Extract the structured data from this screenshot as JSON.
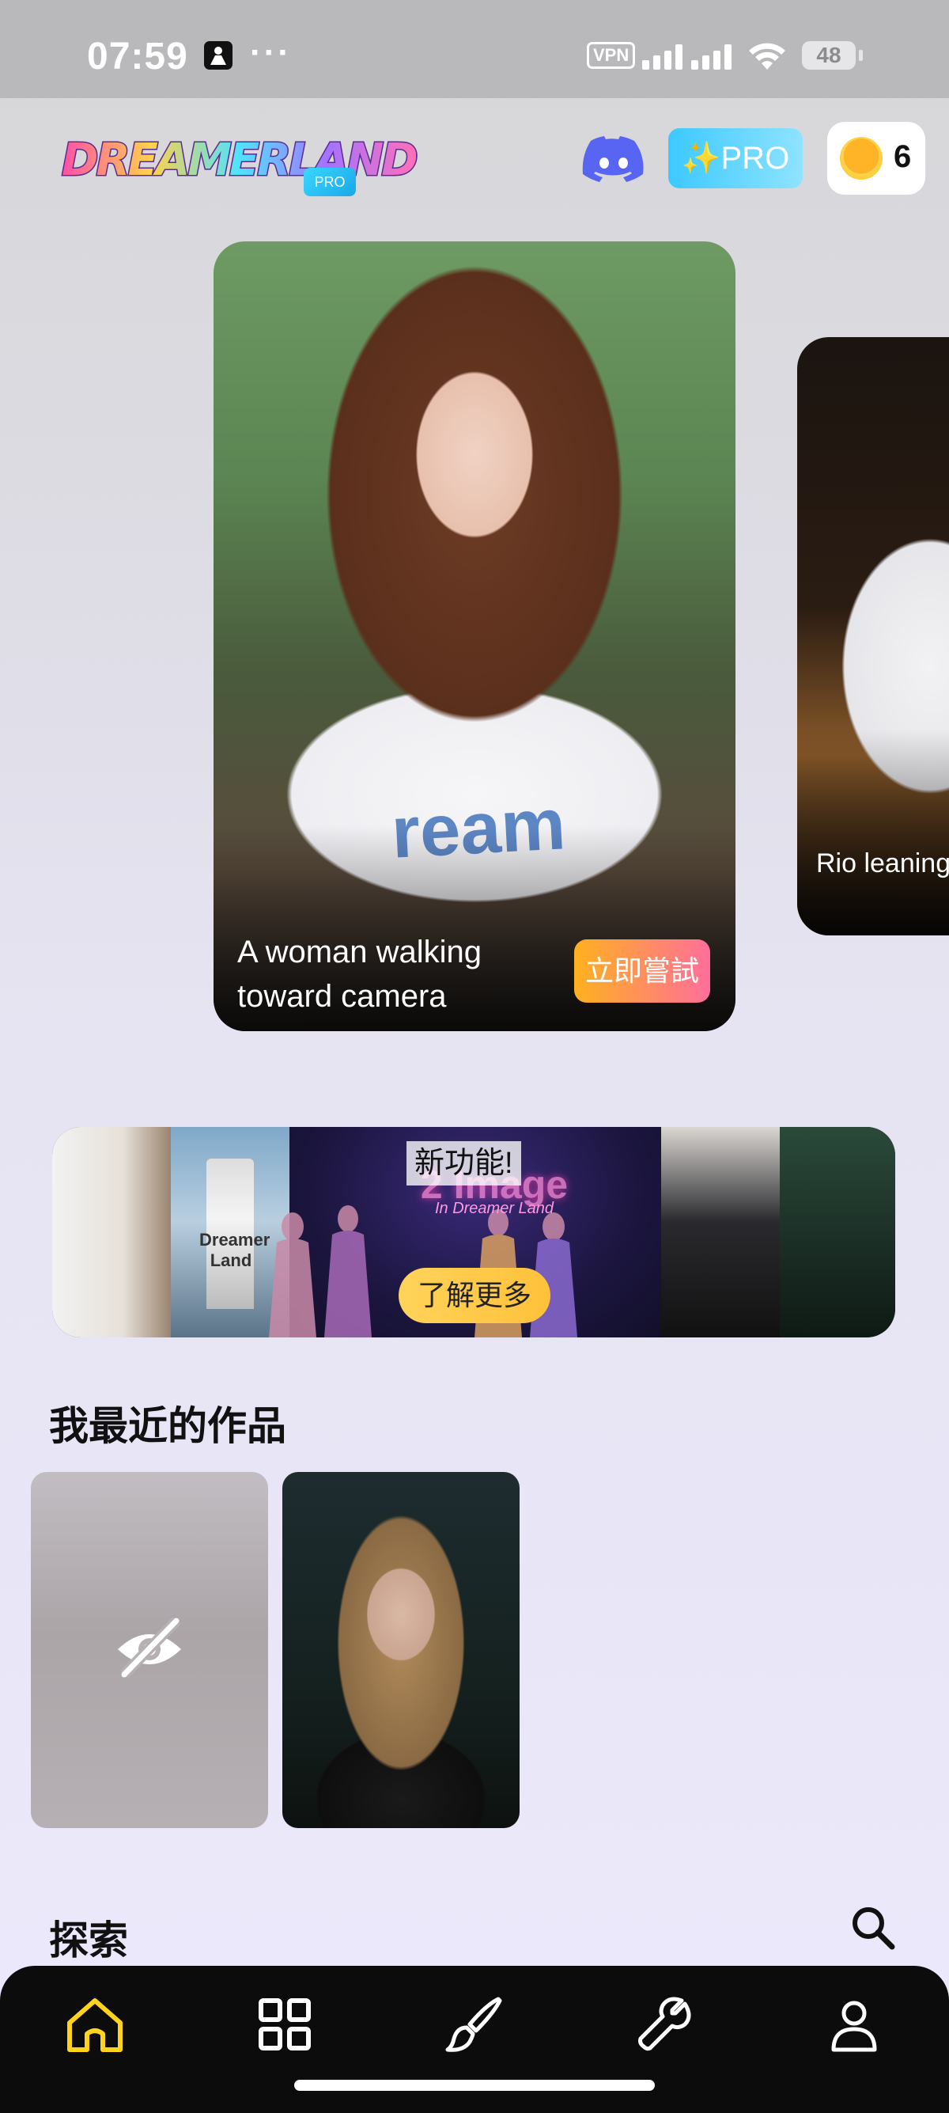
{
  "status_bar": {
    "time": "07:59",
    "dots": "···",
    "vpn": "VPN",
    "battery": "48"
  },
  "header": {
    "logo_text": "DREAMERLAND",
    "logo_badge": "PRO",
    "discord_icon": "discord-icon",
    "pro_button_label": "✨PRO",
    "coin_count": "6",
    "accent_color": "#3cc9ff"
  },
  "featured": {
    "cards": [
      {
        "caption": "A woman walking toward camera",
        "shirt_text": "ream",
        "button_label": "立即嘗試"
      },
      {
        "caption": "Rio leaning forward"
      }
    ]
  },
  "banner": {
    "new_label": "新功能!",
    "neon_title": "2 Image",
    "neon_subtitle": "In Dreamer Land",
    "lighthouse_text": "Dreamer Land",
    "button_label": "了解更多"
  },
  "recent_works": {
    "title": "我最近的作品",
    "items": [
      {
        "type": "hidden",
        "icon": "eye-off-icon"
      },
      {
        "type": "image",
        "subject": "portrait"
      }
    ]
  },
  "explore": {
    "title": "探索",
    "search_icon": "search-icon"
  },
  "bottom_nav": {
    "items": [
      {
        "icon": "home-icon",
        "active": true
      },
      {
        "icon": "grid-icon",
        "active": false
      },
      {
        "icon": "brush-icon",
        "active": false
      },
      {
        "icon": "wrench-icon",
        "active": false
      },
      {
        "icon": "profile-icon",
        "active": false
      }
    ],
    "active_color": "#ffd21e"
  }
}
